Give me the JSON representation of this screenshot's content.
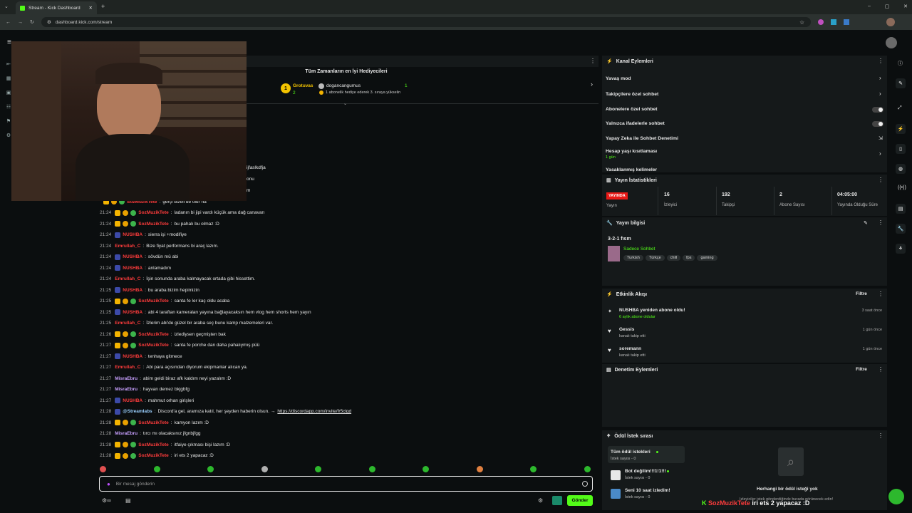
{
  "browser": {
    "tab_title": "Stream - Kick Dashboard",
    "url": "dashboard.kick.com/stream"
  },
  "gifters": {
    "title": "Tüm Zamanların en İyi Hediyecileri",
    "first": "Grotuvas",
    "first_count": "2",
    "second": "dogancangumus",
    "second_count": "1",
    "second_note": "1 abonelik hediye ederek 3. sıraya yükselin"
  },
  "partial_lines": [
    "ijfaslkdfja",
    "onu",
    "m"
  ],
  "chat": [
    {
      "time": "",
      "user": "SozMuzikTete",
      "text": "gerçi dizeli de olur ha",
      "badges": "g"
    },
    {
      "time": "21:24",
      "user": "SozMuzikTete",
      "text": "ladanın bi jipi vardı küçük ama dağ canavarı",
      "badges": "g"
    },
    {
      "time": "21:24",
      "user": "SozMuzikTete",
      "text": "bu pahalı bu olmaz :D",
      "badges": "g"
    },
    {
      "time": "21:24",
      "user": "NUSHBA",
      "text": "sierra işi +modifiye",
      "badges": "n"
    },
    {
      "time": "21:24",
      "user": "Emrullah_C",
      "text": "Bize fiyat performans bi araç lazım.",
      "badges": ""
    },
    {
      "time": "21:24",
      "user": "NUSHBA",
      "text": "sövdün mü abi",
      "badges": "n"
    },
    {
      "time": "21:24",
      "user": "NUSHBA",
      "text": "anlamadım",
      "badges": "n"
    },
    {
      "time": "21:24",
      "user": "Emrullah_C",
      "text": "İşin sonunda araba kalmayacak ortada gibi hissettim.",
      "badges": ""
    },
    {
      "time": "21:25",
      "user": "NUSHBA",
      "text": "bu araba bizim hepimizin",
      "badges": "n"
    },
    {
      "time": "21:25",
      "user": "SozMuzikTete",
      "text": "santa fe ler kaç oldu acaba",
      "badges": "g"
    },
    {
      "time": "21:25",
      "user": "NUSHBA",
      "text": "abi 4 taraftan kameraları yayına bağlayacaksın hem vlog hem shorts hem yayın",
      "badges": "n"
    },
    {
      "time": "21:25",
      "user": "Emrullah_C",
      "text": "İzlerim abi'de güzel bir araba seç bunu kamp malzemeleri var.",
      "badges": ""
    },
    {
      "time": "21:26",
      "user": "SozMuzikTete",
      "text": "izlediysen geçmişten bak",
      "badges": "g"
    },
    {
      "time": "21:27",
      "user": "SozMuzikTete",
      "text": "santa fe porche dan daha pahalıymış püü",
      "badges": "g"
    },
    {
      "time": "21:27",
      "user": "NUSHBA",
      "text": "tenhaya gitmece",
      "badges": "n"
    },
    {
      "time": "21:27",
      "user": "Emrullah_C",
      "text": "Abi para açısından diyorum ekipmanlar alıcan ya.",
      "badges": ""
    },
    {
      "time": "21:27",
      "user": "MisraEbru",
      "text": "abim geldi biraz afk kaldım neyi yazalım :D",
      "badges": ""
    },
    {
      "time": "21:27",
      "user": "MisraEbru",
      "text": "hayvan demez bkjgbfg",
      "badges": ""
    },
    {
      "time": "21:27",
      "user": "NUSHBA",
      "text": "mahmut orhan girişleri",
      "badges": "n"
    },
    {
      "time": "21:28",
      "user": "@Streamlabs",
      "text": "Discord'a gel, aramıza katıl, her şeyden haberin olsun. → ",
      "link": "https://discordapp.com/invite/fr5clgd",
      "badges": "s"
    },
    {
      "time": "21:28",
      "user": "SozMuzikTete",
      "text": "kamyon lazım :D",
      "badges": "g"
    },
    {
      "time": "21:28",
      "user": "MisraEbru",
      "text": "tırcı mı olacaksınız jfgnbjfgg",
      "badges": ""
    },
    {
      "time": "21:28",
      "user": "SozMuzikTete",
      "text": "itfaiye çıkması bişi lazım :D",
      "badges": "g"
    },
    {
      "time": "21:28",
      "user": "SozMuzikTete",
      "text": "iri ets 2 yapacaz :D",
      "badges": "g"
    }
  ],
  "chat_input": {
    "placeholder": "Bir mesaj gönderin",
    "send": "Gönder"
  },
  "channel_actions": {
    "title": "Kanal Eylemleri",
    "items": [
      "Yavaş mod",
      "Takipçilere özel sohbet",
      "Abonelere özel sohbet",
      "Yalnızca ifadelerle sohbet",
      "Yapay Zeka ile Sohbet Denetimi",
      "Hesap yaşı kısıtlaması",
      "Yasaklanmış kelimeler"
    ],
    "account_age_sub": "1 gün"
  },
  "stats": {
    "title": "Yayın İstatistikleri",
    "live": "YAYINDA",
    "live_label": "Yayın",
    "viewers": "16",
    "viewers_label": "İzleyici",
    "followers": "192",
    "followers_label": "Takipçi",
    "subs": "2",
    "subs_label": "Abone Sayısı",
    "uptime": "04:05:00",
    "uptime_label": "Yayında Olduğu Süre"
  },
  "stream_info": {
    "title": "Yayın bilgisi",
    "stream_title": "3-2-1 fısm",
    "category": "Sadece Sohbet",
    "tags": [
      "Turkish",
      "Türkçe",
      "chill",
      "fps",
      "gaming"
    ]
  },
  "activity": {
    "title": "Etkinlik Akışı",
    "filter": "Filtre",
    "items": [
      {
        "title": "NUSHBA yeniden abone oldu!",
        "sub": "6 aylık abone oldular",
        "time": "3 saat önce"
      },
      {
        "title": "Gessis",
        "sub": "kanalı takip etti",
        "time": "1 gün önce"
      },
      {
        "title": "soremann",
        "sub": "kanalı takip etti",
        "time": "1 gün önce"
      }
    ]
  },
  "moderation": {
    "title": "Denetim Eylemleri",
    "filter": "Filtre"
  },
  "rewards": {
    "title": "Ödül İstek sırası",
    "items": [
      {
        "title": "Tüm ödül istekleri",
        "sub": "İstek sayısı - 0"
      },
      {
        "title": "Bot değilim!!!1!1!!!",
        "sub": "İstek sayısı - 0"
      },
      {
        "title": "Seni 10 saat izledim!",
        "sub": "İstek sayısı - 0"
      }
    ],
    "empty": "Herhangi bir ödül isteği yok",
    "empty_sub": "İzleyiciler istek gönderdiğinde burada görünecek edin!"
  },
  "overlay": {
    "user": "SozMuzikTete",
    "text": "iri ets 2 yapacaz :D"
  }
}
